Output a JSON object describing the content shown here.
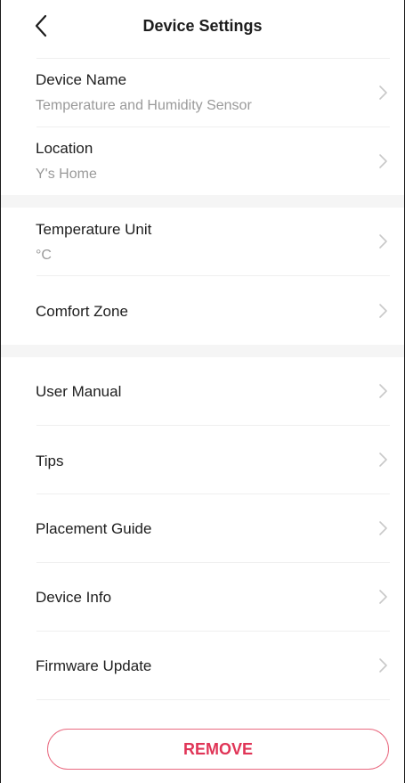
{
  "header": {
    "title": "Device Settings"
  },
  "group1": [
    {
      "label": "Device Name",
      "value": "Temperature and Humidity Sensor"
    },
    {
      "label": "Location",
      "value": "Y's Home"
    }
  ],
  "group2": [
    {
      "label": "Temperature Unit",
      "value": "°C"
    },
    {
      "label": "Comfort Zone"
    }
  ],
  "group3": [
    {
      "label": "User Manual"
    },
    {
      "label": "Tips"
    },
    {
      "label": "Placement Guide"
    },
    {
      "label": "Device Info"
    },
    {
      "label": "Firmware Update"
    }
  ],
  "actions": {
    "remove_label": "REMOVE"
  },
  "colors": {
    "accent": "#e03557",
    "chevron": "#c8c8c8",
    "subtext": "#9a9a9a"
  }
}
